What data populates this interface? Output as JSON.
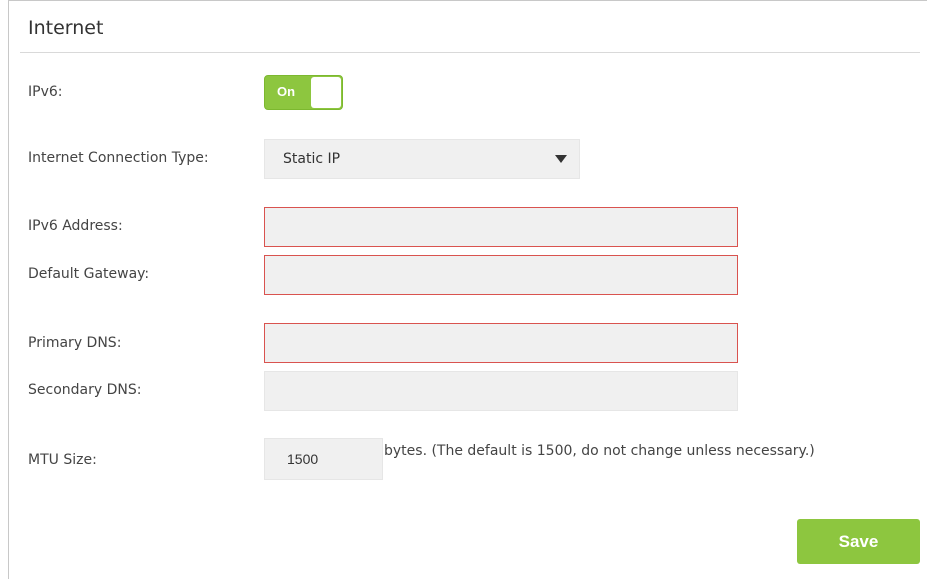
{
  "section": {
    "title": "Internet"
  },
  "ipv6": {
    "label": "IPv6:",
    "toggle_text": "On",
    "enabled": true
  },
  "connection_type": {
    "label": "Internet Connection Type:",
    "value": "Static IP"
  },
  "fields": {
    "ipv6_address": {
      "label": "IPv6 Address:",
      "value": ""
    },
    "default_gateway": {
      "label": "Default Gateway:",
      "value": ""
    },
    "primary_dns": {
      "label": "Primary DNS:",
      "value": ""
    },
    "secondary_dns": {
      "label": "Secondary DNS:",
      "value": ""
    }
  },
  "mtu": {
    "label": "MTU Size:",
    "value": "1500",
    "hint": "bytes. (The default is 1500, do not change unless necessary.)"
  },
  "actions": {
    "save_label": "Save"
  },
  "colors": {
    "accent": "#8dc63f",
    "error_border": "#d9534f",
    "field_bg": "#f0f0f0"
  },
  "icons": {
    "select_caret": "caret-down-icon"
  }
}
